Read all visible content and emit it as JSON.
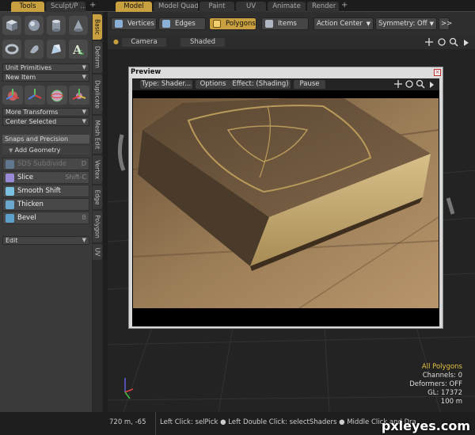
{
  "top_tabs": [
    {
      "label": "Tools",
      "active": true
    },
    {
      "label": "Sculpt/P ...",
      "active": false
    },
    {
      "label": "Model",
      "active": true
    },
    {
      "label": "Model Quad",
      "active": false
    },
    {
      "label": "Paint",
      "active": false
    },
    {
      "label": "UV",
      "active": false
    },
    {
      "label": "Animate",
      "active": false
    },
    {
      "label": "Render",
      "active": false
    }
  ],
  "plus": "+",
  "side_tabs": [
    "Basic",
    "Deform",
    "Duplicate",
    "Mesh Edit",
    "Vertex",
    "Edge",
    "Polygon",
    "UV"
  ],
  "left": {
    "unit_primitives": "Unit Primitives",
    "new_item": "New Item",
    "more_transforms": "More Transforms",
    "center_selected": "Center Selected",
    "snaps": "Snaps and Precision",
    "add_geometry": "Add Geometry",
    "tools": [
      {
        "label": "SDS Subdivide",
        "shortcut": "D",
        "dim": true,
        "color": "#7aa6d8"
      },
      {
        "label": "Slice",
        "shortcut": "Shift-C",
        "dim": false,
        "color": "#9a8ad8"
      },
      {
        "label": "Smooth Shift",
        "shortcut": "",
        "dim": false,
        "color": "#7ac0e0"
      },
      {
        "label": "Thicken",
        "shortcut": "",
        "dim": false,
        "color": "#6aa8d0"
      },
      {
        "label": "Bevel",
        "shortcut": "B",
        "dim": false,
        "color": "#5aa0c8"
      }
    ],
    "edit": "Edit"
  },
  "toolbar": {
    "vertices": "Vertices",
    "edges": "Edges",
    "polygons": "Polygons",
    "items": "Items",
    "action_center": "Action Center",
    "symmetry": "Symmetry: Off",
    "more": ">>"
  },
  "viewport": {
    "camera": "Camera",
    "shaded": "Shaded"
  },
  "preview": {
    "title": "Preview",
    "type": "Type: Shader...",
    "options": "Options",
    "effect": "Effect: (Shading)",
    "pause": "Pause"
  },
  "stats": {
    "selection": "All Polygons",
    "channels": "Channels: 0",
    "deformers": "Deformers: OFF",
    "gl": "GL: 17372",
    "distance": "100 m"
  },
  "status": {
    "coords": "720 m, -65",
    "hint": "Left Click: selPick ● Left Double Click: selectShaders ● Middle Click and Dra"
  },
  "watermark": "pxleyes.com",
  "colors": {
    "accent": "#c8a040",
    "selection": "#e6c040"
  }
}
